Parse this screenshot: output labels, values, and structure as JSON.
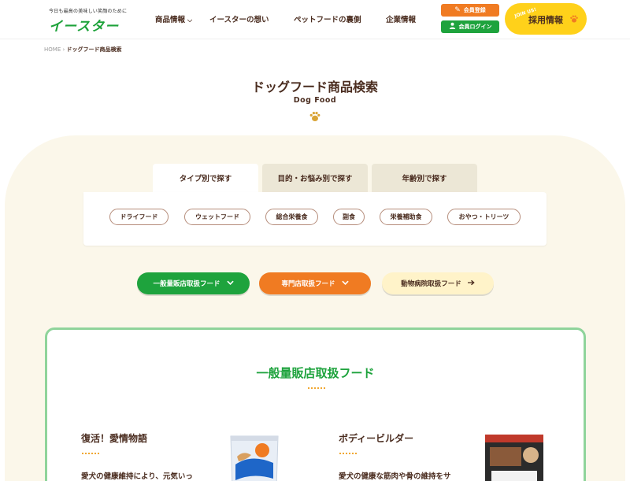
{
  "header": {
    "logo_tagline": "今日も最高の美味しい笑顔のために",
    "logo_text": "イースター",
    "nav": [
      {
        "label": "商品情報"
      },
      {
        "label": "イースターの想い"
      },
      {
        "label": "ペットフードの裏側"
      },
      {
        "label": "企業情報"
      }
    ],
    "register_label": "会員登録",
    "login_label": "会員ログイン",
    "recruit_join": "JOIN US!",
    "recruit_label": "採用情報"
  },
  "breadcrumb": {
    "home": "HOME",
    "separator": "›",
    "current": "ドッグフード商品検索"
  },
  "page": {
    "title": "ドッグフード商品検索",
    "subtitle": "Dog Food"
  },
  "tabs": [
    {
      "label": "タイプ別で探す",
      "active": true
    },
    {
      "label": "目的・お悩み別で探す",
      "active": false
    },
    {
      "label": "年齢別で探す",
      "active": false
    }
  ],
  "type_filters": [
    {
      "label": "ドライフード"
    },
    {
      "label": "ウェットフード"
    },
    {
      "label": "総合栄養食"
    },
    {
      "label": "副食"
    },
    {
      "label": "栄養補助食"
    },
    {
      "label": "おやつ・トリーツ"
    }
  ],
  "categories": [
    {
      "label": "一般量販店取扱フード",
      "icon": "chevron-down-icon"
    },
    {
      "label": "専門店取扱フード",
      "icon": "chevron-down-icon"
    },
    {
      "label": "動物病院取扱フード",
      "icon": "arrow-right-icon"
    }
  ],
  "section": {
    "title": "一般量販店取扱フード"
  },
  "products": [
    {
      "name": "復活！愛情物語",
      "description": "愛犬の健康維持により、元気いっ"
    },
    {
      "name": "ボディービルダー",
      "description": "愛犬の健康な筋肉や骨の維持をサ"
    }
  ],
  "colors": {
    "brand_green": "#1ea33d",
    "brand_orange": "#f07b22",
    "recruit_yellow": "#ffd11a",
    "cream_bg": "#fbf7ea",
    "text_brown": "#4a2c1f"
  }
}
